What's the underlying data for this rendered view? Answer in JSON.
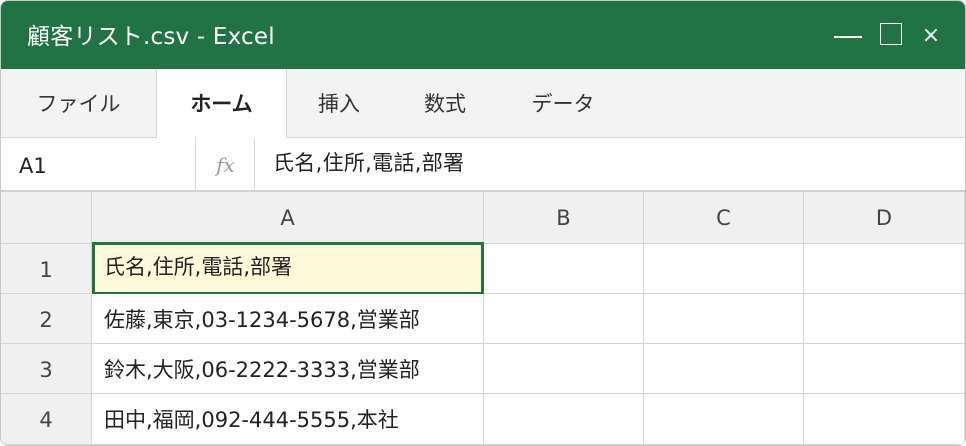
{
  "window": {
    "title": "顧客リスト.csv - Excel",
    "accent_color": "#217346",
    "controls": [
      "minimize-icon",
      "maximize-icon",
      "close-icon"
    ],
    "close_glyph": "×"
  },
  "ribbon": {
    "tabs": [
      {
        "label": "ファイル",
        "active": false
      },
      {
        "label": "ホーム",
        "active": true
      },
      {
        "label": "挿入",
        "active": false
      },
      {
        "label": "数式",
        "active": false
      },
      {
        "label": "データ",
        "active": false
      }
    ]
  },
  "formula_bar": {
    "cell_ref": "A1",
    "fx_label": "fx",
    "formula": "氏名,住所,電話,部署"
  },
  "sheet": {
    "columns": [
      "A",
      "B",
      "C",
      "D"
    ],
    "rows": [
      {
        "num": "1",
        "cells": [
          "氏名,住所,電話,部署",
          "",
          "",
          ""
        ]
      },
      {
        "num": "2",
        "cells": [
          "佐藤,東京,03-1234-5678,営業部",
          "",
          "",
          ""
        ]
      },
      {
        "num": "3",
        "cells": [
          "鈴木,大阪,06-2222-3333,営業部",
          "",
          "",
          ""
        ]
      },
      {
        "num": "4",
        "cells": [
          "田中,福岡,092-444-5555,本社",
          "",
          "",
          ""
        ]
      }
    ],
    "selected_cell": "A1",
    "selected_fill": "#fff8d9"
  }
}
